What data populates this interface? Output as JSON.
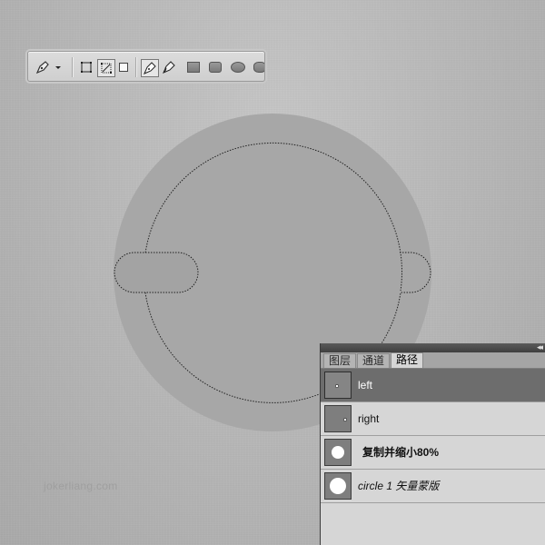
{
  "toolbar": {
    "icons": [
      "pen-tool-icon",
      "dropdown-arrow-icon",
      "shape-layers-icon",
      "paths-icon",
      "fill-pixels-icon",
      "pen-icon",
      "freeform-pen-icon",
      "rectangle-tool-icon",
      "rounded-rectangle-tool-icon",
      "ellipse-tool-icon",
      "polygon-tool-icon"
    ]
  },
  "panel": {
    "tabs": [
      "图层",
      "通道",
      "路径"
    ],
    "active_tab": "路径",
    "collapse_glyph": "◂◂",
    "paths": [
      {
        "name": "left",
        "selected": true,
        "thumb": "small-dot"
      },
      {
        "name": "right",
        "selected": false,
        "thumb": "small-dot"
      },
      {
        "name": "复制并缩小80%",
        "selected": false,
        "thumb": "white-circle"
      },
      {
        "name": "circle 1 矢量蒙版",
        "selected": false,
        "thumb": "white-circle"
      }
    ]
  },
  "watermark": "jokerliang.com",
  "colors": {
    "background": "#bcbcbc",
    "disc": "#a7a7a7",
    "panel": "#d6d6d6",
    "selected_row": "#6d6d6d"
  }
}
